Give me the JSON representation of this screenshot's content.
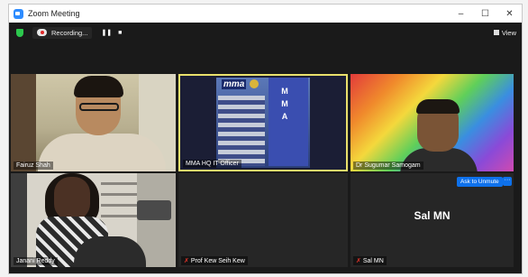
{
  "window": {
    "title": "Zoom Meeting",
    "controls": {
      "minimize": "–",
      "maximize": "☐",
      "close": "✕"
    }
  },
  "toolbar": {
    "recording_label": "Recording...",
    "pause_icon": "❚❚",
    "stop_icon": "■",
    "view_label": "View"
  },
  "participants": [
    {
      "name": "Fairuz Shah",
      "muted": false
    },
    {
      "name": "MMA HQ IT Officer",
      "muted": false,
      "active_speaker": true
    },
    {
      "name": "Dr Sugumar Samogam",
      "muted": false
    },
    {
      "name": "Janani Reddy",
      "muted": false
    },
    {
      "name": "Prof Kew Seih Kew",
      "muted": true,
      "video_off": true
    },
    {
      "name": "Sal MN",
      "muted": true,
      "video_off": true,
      "display_name": "Sal MN"
    }
  ],
  "tile_actions": {
    "ask_to_unmute": "Ask to Unmute",
    "more": "···"
  },
  "branding": {
    "building_logo": "mma",
    "building_letters": [
      "M",
      "M",
      "A"
    ]
  },
  "colors": {
    "active_speaker_border": "#e9e16c",
    "unmute_button": "#0e71eb",
    "muted_mic": "#e0342a",
    "security_shield": "#2cc84d"
  }
}
